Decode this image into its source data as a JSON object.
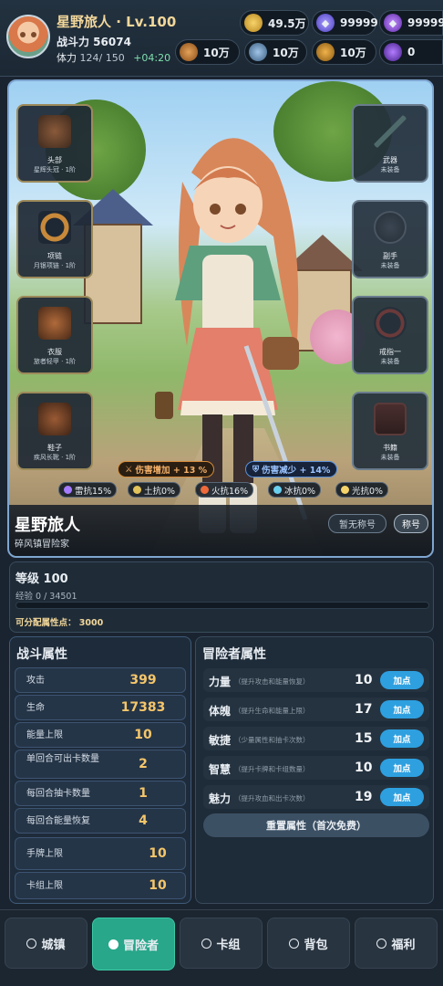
{
  "header": {
    "player_name": "星野旅人 · Lv.100",
    "power_label": "战斗力 56074",
    "stamina_label": "体力",
    "stamina_value": "124/ 150",
    "stamina_regen": "+04:20",
    "currencies_row1": [
      {
        "icon": "gold-coin-icon",
        "value": "49.5万"
      },
      {
        "icon": "blue-gem-icon",
        "value": "99999"
      },
      {
        "icon": "purple-gem-icon",
        "value": "99999"
      }
    ],
    "currencies_row2": [
      {
        "icon": "bronze-token-icon",
        "value": "10万"
      },
      {
        "icon": "silver-token-icon",
        "value": "10万"
      },
      {
        "icon": "amber-token-icon",
        "value": "10万"
      },
      {
        "icon": "violet-orb-icon",
        "value": "0"
      }
    ]
  },
  "hero": {
    "name": "星野旅人",
    "title": "碎风镇冒险家",
    "no_title_button": "暂无称号",
    "title_button": "称号",
    "left_slots": [
      {
        "name": "头部",
        "item": "星辉头冠 · 1阶"
      },
      {
        "name": "项链",
        "item": "月银项链 · 1阶"
      },
      {
        "name": "衣服",
        "item": "旅者轻甲 · 1阶"
      },
      {
        "name": "鞋子",
        "item": "疾风长靴 · 1阶"
      }
    ],
    "right_slots": [
      {
        "name": "武器",
        "item": "未装备"
      },
      {
        "name": "副手",
        "item": "未装备"
      },
      {
        "name": "戒指一",
        "item": "未装备"
      },
      {
        "name": "书籍",
        "item": "未装备"
      }
    ],
    "buff_damage": "伤害增加 + 13 %",
    "buff_defense": "伤害减少 + 14%",
    "resistances": [
      "雷抗15%",
      "土抗0%",
      "火抗16%",
      "冰抗0%",
      "光抗0%"
    ]
  },
  "level": {
    "title": "等级 100",
    "exp": "经验 0 / 34501",
    "exp_progress": 0.0,
    "points": "可分配属性点： 3000"
  },
  "battle": {
    "title": "战斗属性",
    "stats": [
      {
        "label": "攻击",
        "value": "399"
      },
      {
        "label": "生命",
        "value": "17383"
      },
      {
        "label": "能量上限",
        "value": "10"
      },
      {
        "label": "单回合可出卡数量",
        "value": "2"
      },
      {
        "label": "每回合抽卡数量",
        "value": "1"
      },
      {
        "label": "每回合能量恢复",
        "value": "4"
      },
      {
        "label": "手牌上限",
        "value": "10"
      },
      {
        "label": "卡组上限",
        "value": "10"
      }
    ]
  },
  "adventurer": {
    "title": "冒险者属性",
    "attrs": [
      {
        "name": "力量",
        "desc": "（提升攻击和能量恢复）",
        "value": "10",
        "button": "加点"
      },
      {
        "name": "体魄",
        "desc": "（提升生命和能量上限）",
        "value": "17",
        "button": "加点"
      },
      {
        "name": "敏捷",
        "desc": "（少量属性和抽卡次数）",
        "value": "15",
        "button": "加点"
      },
      {
        "name": "智慧",
        "desc": "（提升卡牌和卡组数量）",
        "value": "10",
        "button": "加点"
      },
      {
        "name": "魅力",
        "desc": "（提升攻血和出卡次数）",
        "value": "19",
        "button": "加点"
      }
    ],
    "reset_button": "重置属性（首次免费）"
  },
  "nav": {
    "tabs": [
      {
        "label": "城镇",
        "active": false
      },
      {
        "label": "冒险者",
        "active": true
      },
      {
        "label": "卡组",
        "active": false
      },
      {
        "label": "背包",
        "active": false
      },
      {
        "label": "福利",
        "active": false
      }
    ]
  },
  "colors": {
    "accent_teal": "#28a78a",
    "button_blue": "#2ea0e0",
    "gold_value": "#f5c66a",
    "background": "#1a2430"
  }
}
